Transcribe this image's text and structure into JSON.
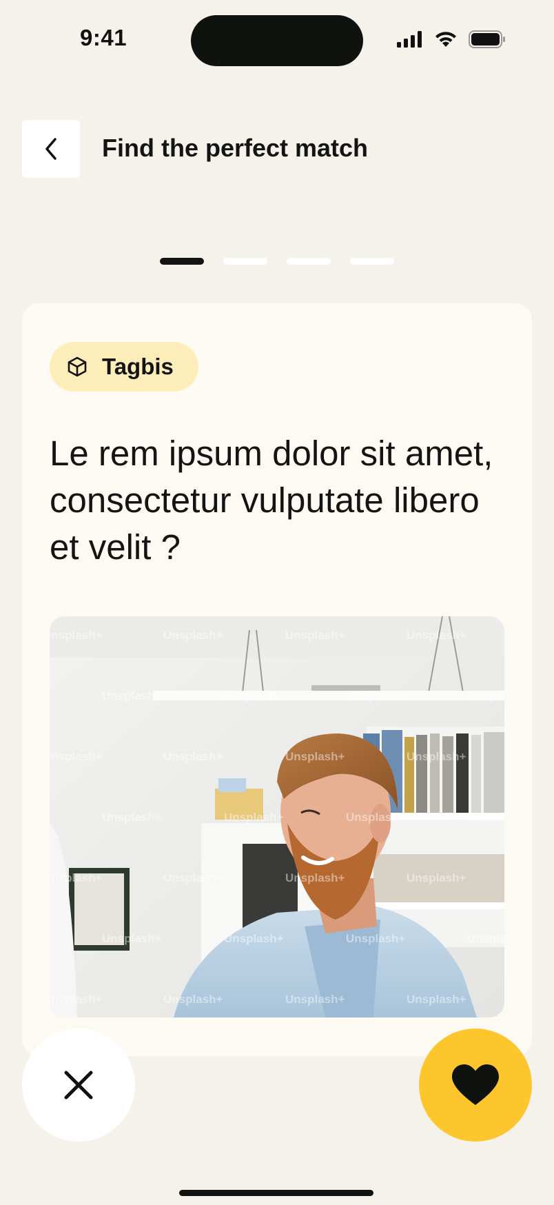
{
  "status_bar": {
    "time": "9:41"
  },
  "header": {
    "back_icon": "chevron-left-icon",
    "title": "Find the perfect match"
  },
  "progress": {
    "total_steps": 4,
    "current_step": 1
  },
  "card": {
    "tag": {
      "icon": "box-icon",
      "label": "Tagbis"
    },
    "question": "Le rem ipsum dolor sit amet, consectetur vulputate libero et velit ?",
    "photo": {
      "icon": "photo-of-smiling-man-in-office",
      "watermark": "Unsplash+"
    }
  },
  "actions": {
    "dismiss_icon": "close-icon",
    "like_icon": "heart-icon"
  },
  "colors": {
    "background": "#f5f2ec",
    "card": "#fdfaf3",
    "tag_background": "#fdedb8",
    "accent": "#fdc62c",
    "text": "#141414"
  }
}
